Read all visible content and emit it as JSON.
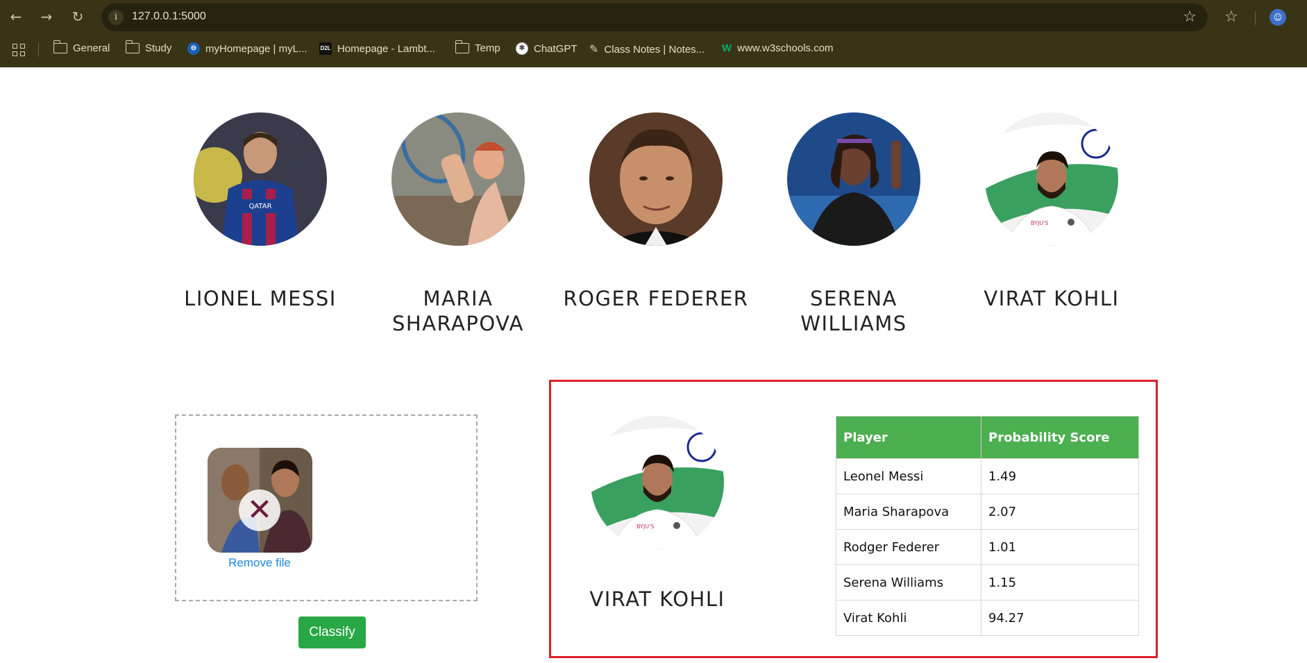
{
  "browser": {
    "url": "127.0.0.1:5000",
    "bookmarks": [
      {
        "label": "General",
        "icon": "folder-icon"
      },
      {
        "label": "Study",
        "icon": "folder-icon"
      },
      {
        "label": "myHomepage | myL...",
        "icon": "site-favicon"
      },
      {
        "label": "Homepage - Lambt...",
        "icon": "d2l-favicon"
      },
      {
        "label": "Temp",
        "icon": "folder-icon"
      },
      {
        "label": "ChatGPT",
        "icon": "chatgpt-icon"
      },
      {
        "label": "Class Notes | Notes...",
        "icon": "pen-icon"
      },
      {
        "label": "www.w3schools.com",
        "icon": "w3schools-icon"
      }
    ]
  },
  "celebrities": [
    {
      "name": "LIONEL MESSI"
    },
    {
      "name": "MARIA SHARAPOVA"
    },
    {
      "name": "ROGER FEDERER"
    },
    {
      "name": "SERENA WILLIAMS"
    },
    {
      "name": "VIRAT KOHLI"
    }
  ],
  "upload": {
    "remove_label": "Remove file",
    "classify_label": "Classify"
  },
  "result": {
    "name": "VIRAT KOHLI",
    "table": {
      "headers": [
        "Player",
        "Probability Score"
      ],
      "rows": [
        [
          "Leonel Messi",
          "1.49"
        ],
        [
          "Maria Sharapova",
          "2.07"
        ],
        [
          "Rodger Federer",
          "1.01"
        ],
        [
          "Serena Williams",
          "1.15"
        ],
        [
          "Virat Kohli",
          "94.27"
        ]
      ]
    }
  },
  "colors": {
    "chrome_bg": "#3a3416",
    "classify_button": "#28a745",
    "table_header": "#4caf50",
    "result_border": "#e0202a",
    "link": "#1e88d9"
  }
}
